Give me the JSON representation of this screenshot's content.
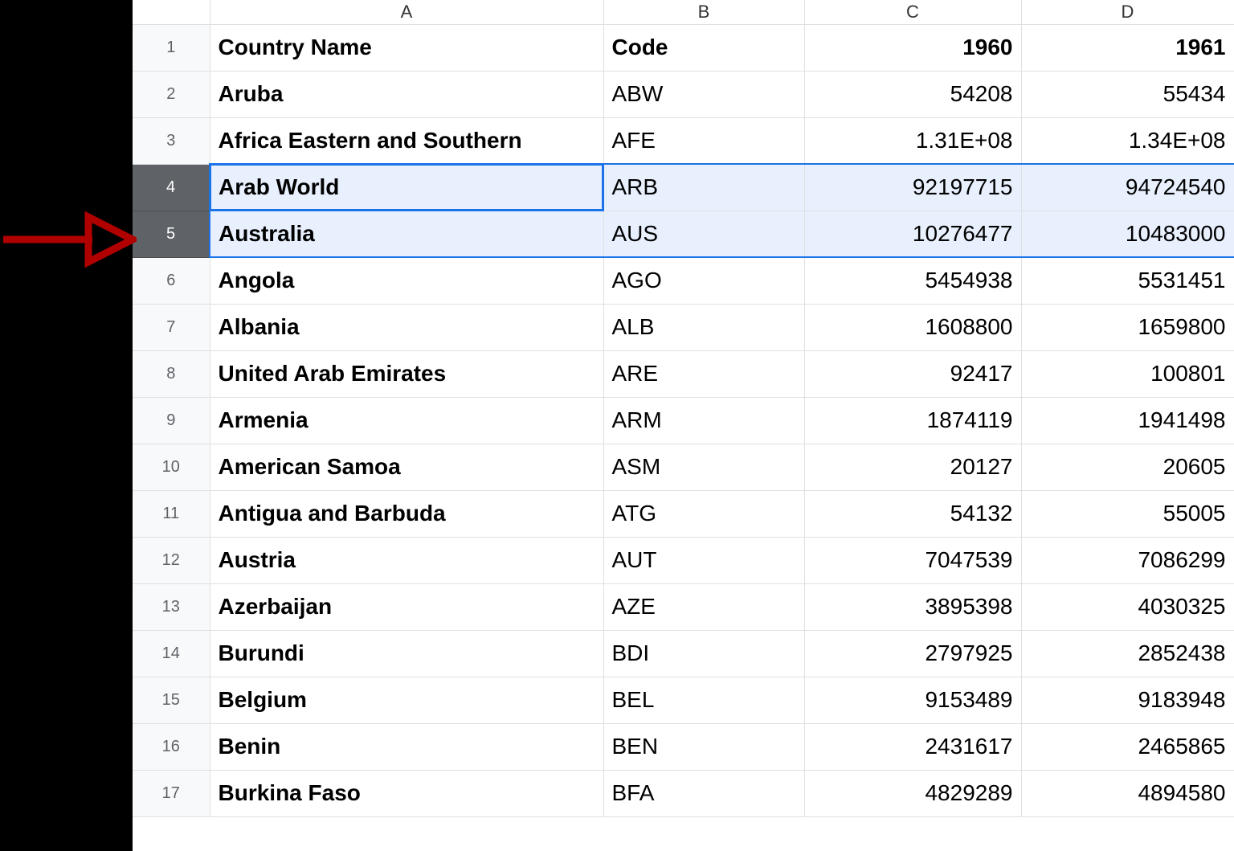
{
  "columns": {
    "A": "A",
    "B": "B",
    "C": "C",
    "D": "D"
  },
  "header": {
    "a": "Country Name",
    "b": "Code",
    "c": "1960",
    "d": "1961"
  },
  "rows": [
    {
      "n": "1",
      "a": "Country Name",
      "b": "Code",
      "c": "1960",
      "d": "1961",
      "hdr": true
    },
    {
      "n": "2",
      "a": "Aruba",
      "b": "ABW",
      "c": "54208",
      "d": "55434"
    },
    {
      "n": "3",
      "a": "Africa Eastern and Southern",
      "b": "AFE",
      "c": "1.31E+08",
      "d": "1.34E+08"
    },
    {
      "n": "4",
      "a": "Arab World",
      "b": "ARB",
      "c": "92197715",
      "d": "94724540",
      "selected": true,
      "active": true,
      "selTop": true
    },
    {
      "n": "5",
      "a": "Australia",
      "b": "AUS",
      "c": "10276477",
      "d": "10483000",
      "selected": true,
      "selBottom": true
    },
    {
      "n": "6",
      "a": "Angola",
      "b": "AGO",
      "c": "5454938",
      "d": "5531451"
    },
    {
      "n": "7",
      "a": "Albania",
      "b": "ALB",
      "c": "1608800",
      "d": "1659800"
    },
    {
      "n": "8",
      "a": "United Arab Emirates",
      "b": "ARE",
      "c": "92417",
      "d": "100801"
    },
    {
      "n": "9",
      "a": "Armenia",
      "b": "ARM",
      "c": "1874119",
      "d": "1941498"
    },
    {
      "n": "10",
      "a": "American Samoa",
      "b": "ASM",
      "c": "20127",
      "d": "20605"
    },
    {
      "n": "11",
      "a": "Antigua and Barbuda",
      "b": "ATG",
      "c": "54132",
      "d": "55005"
    },
    {
      "n": "12",
      "a": "Austria",
      "b": "AUT",
      "c": "7047539",
      "d": "7086299"
    },
    {
      "n": "13",
      "a": "Azerbaijan",
      "b": "AZE",
      "c": "3895398",
      "d": "4030325"
    },
    {
      "n": "14",
      "a": "Burundi",
      "b": "BDI",
      "c": "2797925",
      "d": "2852438"
    },
    {
      "n": "15",
      "a": "Belgium",
      "b": "BEL",
      "c": "9153489",
      "d": "9183948"
    },
    {
      "n": "16",
      "a": "Benin",
      "b": "BEN",
      "c": "2431617",
      "d": "2465865"
    },
    {
      "n": "17",
      "a": "Burkina Faso",
      "b": "BFA",
      "c": "4829289",
      "d": "4894580"
    }
  ],
  "annotation": {
    "arrow_target_row": "4"
  }
}
